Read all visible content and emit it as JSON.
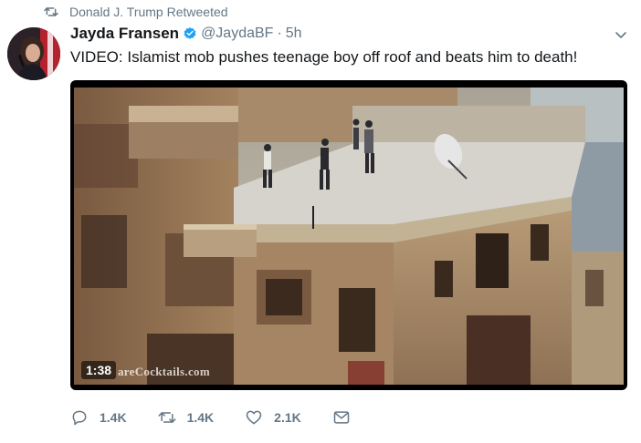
{
  "retweet_context": {
    "text": "Donald J. Trump Retweeted",
    "icon": "retweet-icon"
  },
  "tweet": {
    "display_name": "Jayda Fransen",
    "handle": "@JaydaBF",
    "separator": "·",
    "time": "5h",
    "verified": true,
    "text": "VIDEO: Islamist mob pushes teenage boy off roof and beats him to death!"
  },
  "video": {
    "duration": "1:38",
    "watermark": "areCocktails.com"
  },
  "actions": {
    "reply_count": "1.4K",
    "retweet_count": "1.4K",
    "like_count": "2.1K"
  },
  "colors": {
    "text_primary": "#14171a",
    "text_secondary": "#657786",
    "verified_blue": "#1da1f2"
  }
}
